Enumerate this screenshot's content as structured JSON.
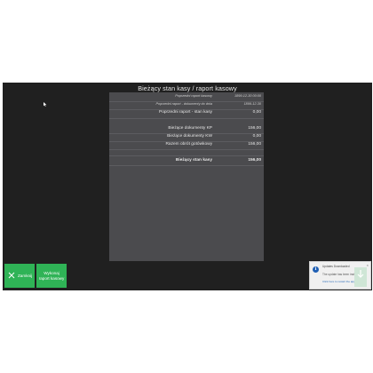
{
  "window": {
    "title": "Bieżący stan kasy / raport kasowy"
  },
  "rows": [
    {
      "label": "Poprzedni raport kasowy",
      "value": "1899-12-30 00:00",
      "style": "italic"
    },
    {
      "label": "Poprzedni raport - dokumenty do dnia",
      "value": "1899-12-30",
      "style": "italic"
    },
    {
      "label": "Poprzedni raport - stan kasy",
      "value": "0,00",
      "style": "normal"
    },
    {
      "label": "Bieżące dokumenty KP",
      "value": "156,00",
      "style": "normal"
    },
    {
      "label": "Bieżące dokumenty KW",
      "value": "0,00",
      "style": "normal"
    },
    {
      "label": "Razem obrót gotówkowy",
      "value": "156,00",
      "style": "normal"
    },
    {
      "label": "Bieżący stan kasy",
      "value": "156,00",
      "style": "bold"
    }
  ],
  "buttons": {
    "close_label": "Zamknij",
    "report_label_line1": "Wykonaj",
    "report_label_line2": "raport kasowy"
  },
  "notification": {
    "title": "Updates Downloaded",
    "message": "The update has been installed.",
    "link": "Click here to restart the application",
    "close": "×",
    "info": "i"
  },
  "colors": {
    "background": "#202020",
    "panel": "#4b4b4e",
    "button": "#2fb356",
    "text": "#e6e6e6"
  }
}
